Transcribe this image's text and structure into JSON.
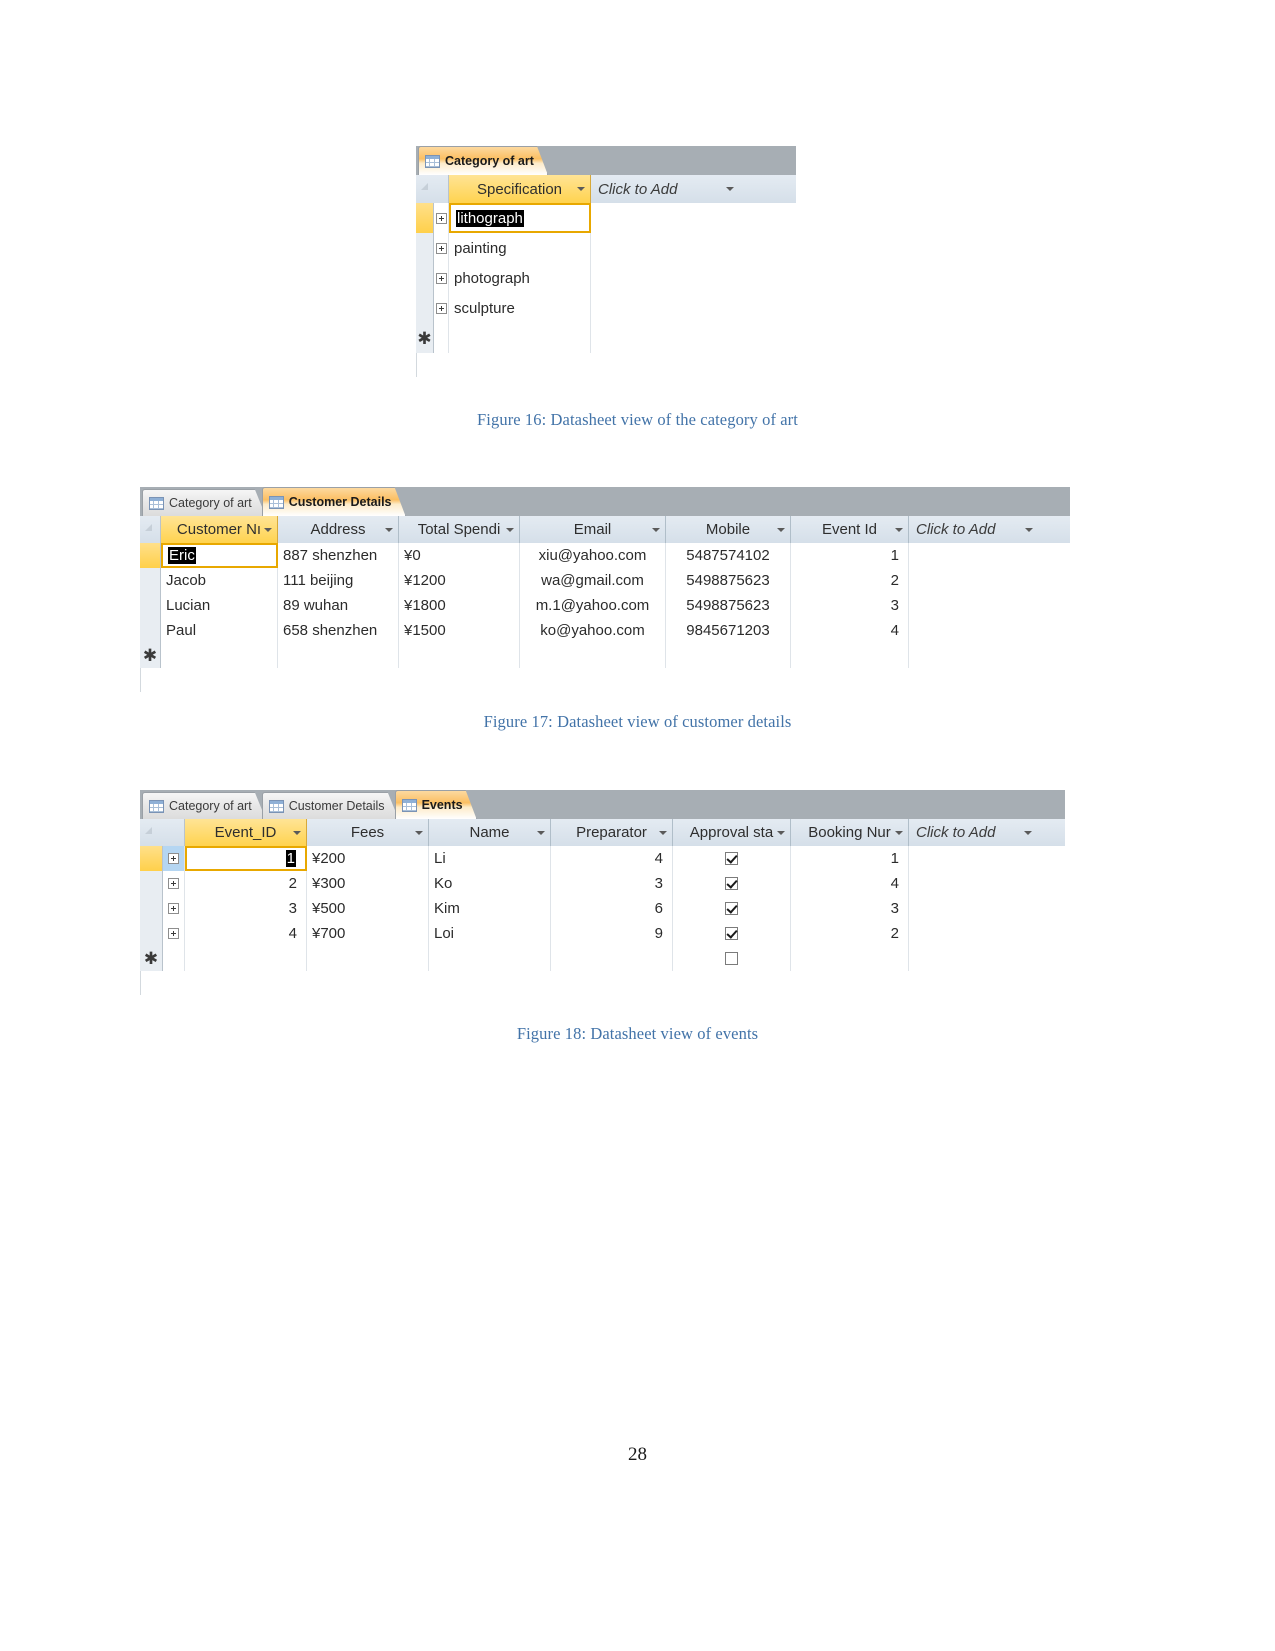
{
  "page": {
    "number": "28"
  },
  "figures": [
    {
      "id": "fig16",
      "caption": "Figure 16: Datasheet view of the category of art",
      "tabs": [
        {
          "label": "Category of art",
          "active": true
        }
      ],
      "columns": [
        {
          "label": "Specification",
          "selected": true,
          "type": "text"
        },
        {
          "label": "Click to Add",
          "selected": false,
          "type": "add"
        }
      ],
      "rows": [
        {
          "specification": "lithograph",
          "editing": true,
          "selected": true
        },
        {
          "specification": "painting",
          "editing": false,
          "selected": false
        },
        {
          "specification": "photograph",
          "editing": false,
          "selected": false
        },
        {
          "specification": "sculpture",
          "editing": false,
          "selected": false
        }
      ],
      "new_record_marker": "✱"
    },
    {
      "id": "fig17",
      "caption": "Figure 17: Datasheet view of customer details",
      "tabs": [
        {
          "label": "Category of art",
          "active": false
        },
        {
          "label": "Customer Details",
          "active": true
        }
      ],
      "columns": [
        {
          "label": "Customer Nı",
          "selected": true,
          "type": "text"
        },
        {
          "label": "Address",
          "selected": false,
          "type": "text"
        },
        {
          "label": "Total Spendi",
          "selected": false,
          "type": "text"
        },
        {
          "label": "Email",
          "selected": false,
          "type": "text"
        },
        {
          "label": "Mobile",
          "selected": false,
          "type": "text"
        },
        {
          "label": "Event Id",
          "selected": false,
          "type": "number"
        },
        {
          "label": "Click to Add",
          "selected": false,
          "type": "add"
        }
      ],
      "rows": [
        {
          "customer_name": "Eric",
          "address": "887 shenzhen",
          "total_spending": "¥0",
          "email": "xiu@yahoo.com",
          "mobile": "5487574102",
          "event_id": "1",
          "editing": true,
          "selected": true
        },
        {
          "customer_name": "Jacob",
          "address": "111 beijing",
          "total_spending": "¥1200",
          "email": "wa@gmail.com",
          "mobile": "5498875623",
          "event_id": "2",
          "editing": false,
          "selected": false
        },
        {
          "customer_name": "Lucian",
          "address": "89 wuhan",
          "total_spending": "¥1800",
          "email": "m.1@yahoo.com",
          "mobile": "5498875623",
          "event_id": "3",
          "editing": false,
          "selected": false
        },
        {
          "customer_name": "Paul",
          "address": "658 shenzhen",
          "total_spending": "¥1500",
          "email": "ko@yahoo.com",
          "mobile": "9845671203",
          "event_id": "4",
          "editing": false,
          "selected": false
        }
      ],
      "new_record_marker": "✱"
    },
    {
      "id": "fig18",
      "caption": "Figure 18: Datasheet view of events",
      "tabs": [
        {
          "label": "Category of art",
          "active": false
        },
        {
          "label": "Customer Details",
          "active": false
        },
        {
          "label": "Events",
          "active": true
        }
      ],
      "columns": [
        {
          "label": "Event_ID",
          "selected": true,
          "type": "number"
        },
        {
          "label": "Fees",
          "selected": false,
          "type": "text"
        },
        {
          "label": "Name",
          "selected": false,
          "type": "text"
        },
        {
          "label": "Preparator",
          "selected": false,
          "type": "number"
        },
        {
          "label": "Approval sta",
          "selected": false,
          "type": "checkbox"
        },
        {
          "label": "Booking Nur",
          "selected": false,
          "type": "number"
        },
        {
          "label": "Click to Add",
          "selected": false,
          "type": "add"
        }
      ],
      "rows": [
        {
          "event_id": "1",
          "fees": "¥200",
          "name": "Li",
          "preparator": "4",
          "approval_status": true,
          "booking_number": "1",
          "editing": true,
          "selected": true
        },
        {
          "event_id": "2",
          "fees": "¥300",
          "name": "Ko",
          "preparator": "3",
          "approval_status": true,
          "booking_number": "4",
          "editing": false,
          "selected": false
        },
        {
          "event_id": "3",
          "fees": "¥500",
          "name": "Kim",
          "preparator": "6",
          "approval_status": true,
          "booking_number": "3",
          "editing": false,
          "selected": false
        },
        {
          "event_id": "4",
          "fees": "¥700",
          "name": "Loi",
          "preparator": "9",
          "approval_status": true,
          "booking_number": "2",
          "editing": false,
          "selected": false
        }
      ],
      "new_record": {
        "approval_status": false
      },
      "new_record_marker": "✱"
    }
  ],
  "colors": {
    "caption": "#4273a8",
    "tab_active": "#fbbf63",
    "selected_row": "#b5d6f2",
    "selected_header": "#ffd34f",
    "tabstrip": "#a7aeb4"
  }
}
